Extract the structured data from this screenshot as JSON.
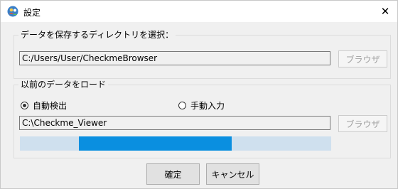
{
  "window": {
    "title": "設定",
    "close_glyph": "✕",
    "app_icon": "globe-person-icon"
  },
  "save_dir_group": {
    "label": "データを保存するディレクトリを選択：",
    "path_value": "C:/Users/User/CheckmeBrowser",
    "browse_label": "ブラウザ",
    "browse_enabled": false
  },
  "load_group": {
    "label": "以前のデータをロード",
    "radio_auto_label": "自動検出",
    "radio_auto_checked": true,
    "radio_manual_label": "手動入力",
    "radio_manual_checked": false,
    "path_value": "C:\\Checkme_Viewer",
    "browse_label": "ブラウザ",
    "browse_enabled": false,
    "progress": {
      "type": "indeterminate",
      "segment_start": 0.19,
      "segment_end": 0.68,
      "track_color": "#cfe0ee",
      "fill_color": "#0a8fe0"
    }
  },
  "buttons": {
    "ok_label": "確定",
    "cancel_label": "キャンセル"
  }
}
